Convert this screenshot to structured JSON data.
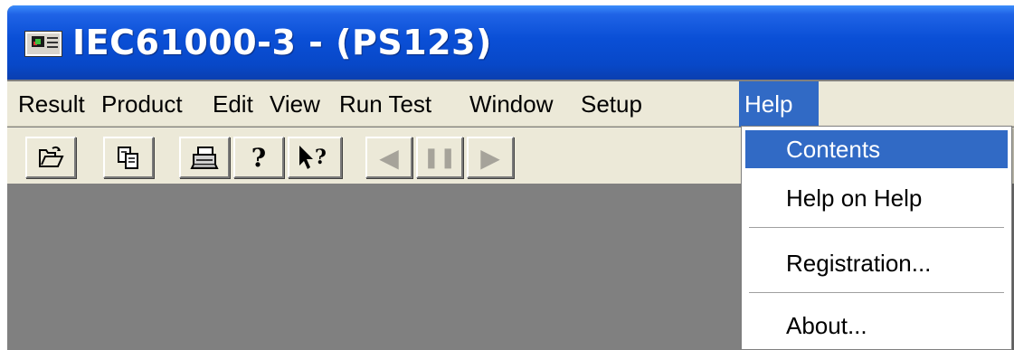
{
  "window": {
    "title": "IEC61000-3 - (PS123)",
    "icon": "app-monitor-icon"
  },
  "menubar": {
    "items": [
      {
        "label": "Result"
      },
      {
        "label": "Product"
      },
      {
        "label": "Edit"
      },
      {
        "label": "View"
      },
      {
        "label": "Run Test"
      },
      {
        "label": "Window"
      },
      {
        "label": "Setup"
      },
      {
        "label": "Help",
        "active": true
      }
    ]
  },
  "toolbar": {
    "buttons": [
      {
        "name": "open-icon",
        "glyph": ""
      },
      {
        "name": "copy-icon",
        "glyph": ""
      },
      {
        "name": "print-icon",
        "glyph": ""
      },
      {
        "name": "help-icon",
        "glyph": "?"
      },
      {
        "name": "context-help-icon",
        "glyph": "?"
      },
      {
        "name": "back-icon",
        "glyph": "◀",
        "disabled": true
      },
      {
        "name": "pause-icon",
        "glyph": "❚❚",
        "disabled": true
      },
      {
        "name": "play-icon",
        "glyph": "▶",
        "disabled": true
      }
    ]
  },
  "help_menu": {
    "items": [
      {
        "label": "Contents",
        "selected": true
      },
      {
        "label": "Help on Help"
      },
      {
        "label": "Registration..."
      },
      {
        "label": "About..."
      }
    ]
  },
  "colors": {
    "titlebar": "#0a4fd6",
    "menu_highlight": "#316ac5",
    "face": "#ece9d8",
    "workspace": "#808080"
  }
}
